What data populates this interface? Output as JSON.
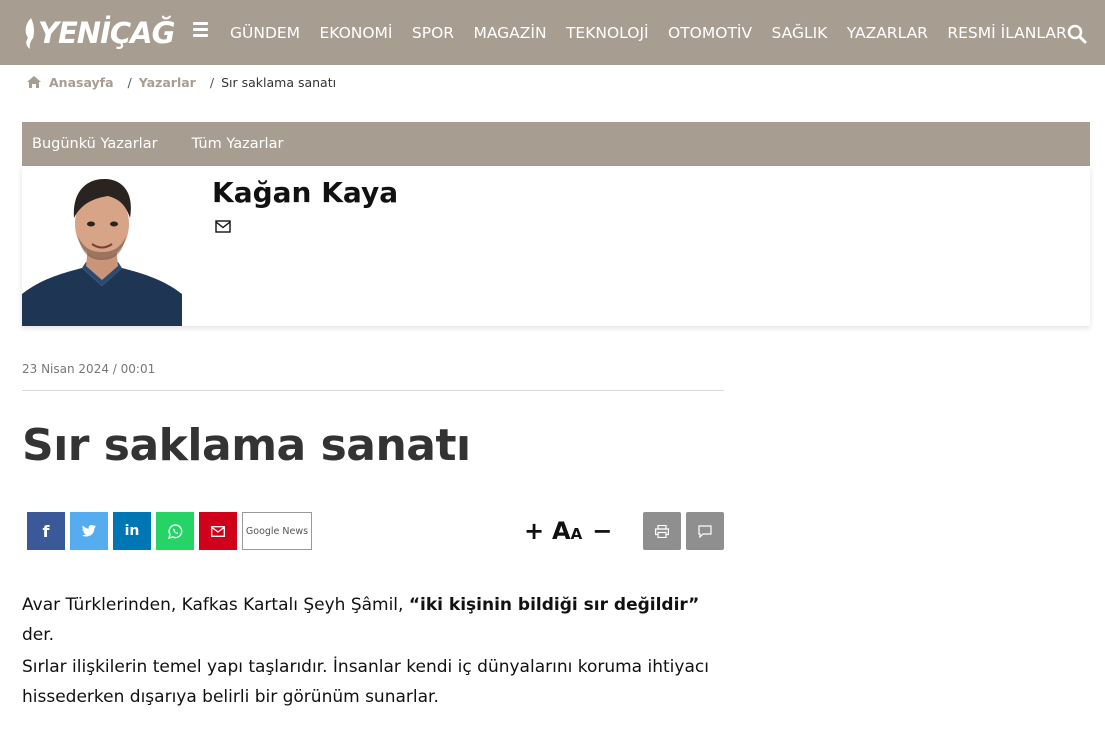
{
  "site": {
    "logo_text": "YENİÇAĞ",
    "nav": [
      "GÜNDEM",
      "EKONOMİ",
      "SPOR",
      "MAGAZİN",
      "TEKNOLOJİ",
      "OTOMOTİV",
      "SAĞLIK",
      "YAZARLAR",
      "RESMİ İLANLAR"
    ],
    "brand_color": "#a89d91"
  },
  "breadcrumb": {
    "home": "Anasayfa",
    "sep": "/",
    "section": "Yazarlar",
    "current": "Sır saklama sanatı"
  },
  "author_box": {
    "tabs": [
      "Bugünkü Yazarlar",
      "Tüm Yazarlar"
    ],
    "name": "Kağan Kaya"
  },
  "article": {
    "date": "23 Nisan 2024 / 00:01",
    "title": "Sır saklama sanatı",
    "share": {
      "facebook": "f",
      "twitter": "t",
      "linkedin": "in",
      "google_news_1": "Google",
      "google_news_2": "News"
    },
    "font_controls": {
      "plus": "+",
      "aa_big": "A",
      "aa_small": "A",
      "minus": "−"
    },
    "paragraph1_pre": "Avar Türklerinden, Kafkas Kartalı Şeyh Şâmil, ",
    "paragraph1_bold": "“iki kişinin bildiği sır değildir”",
    "paragraph1_post": " der.",
    "paragraph2": "Sırlar ilişkilerin temel yapı taşlarıdır. İnsanlar kendi iç dünyalarını koruma ihtiyacı hissederken dışarıya belirli bir görünüm sunarlar."
  }
}
